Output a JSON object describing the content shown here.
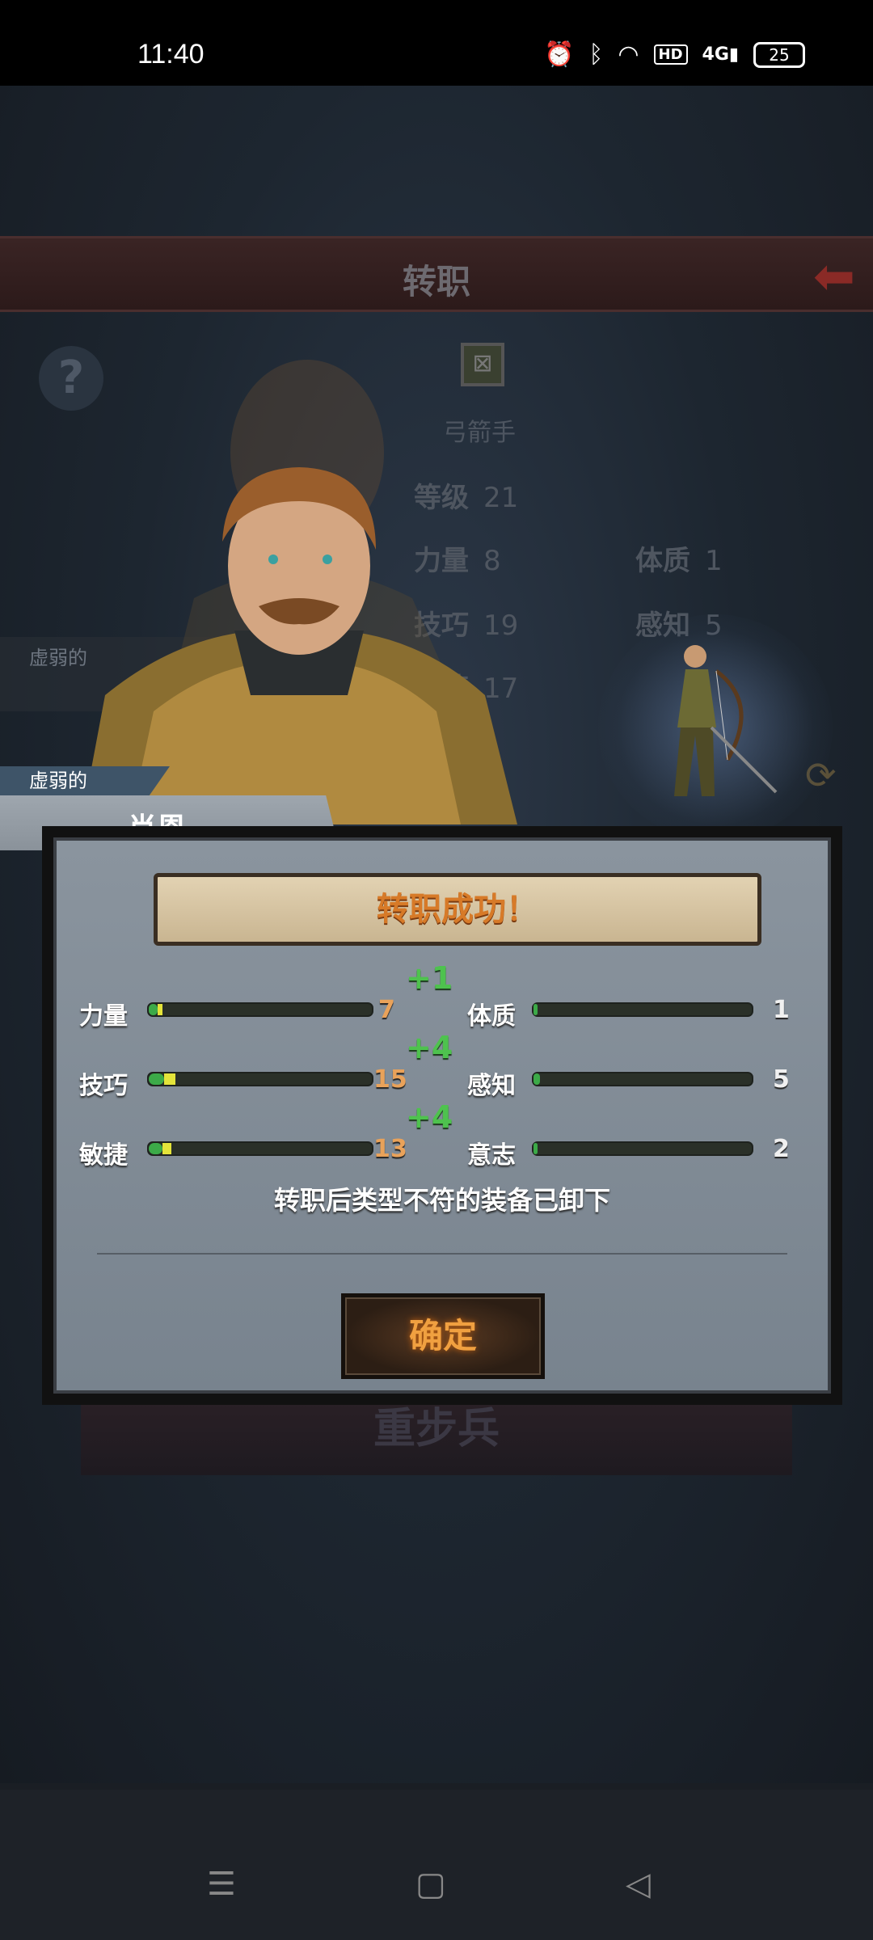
{
  "status_bar": {
    "time": "11:40",
    "icons": [
      "alarm-icon",
      "bluetooth-icon",
      "wifi-icon",
      "hd-icon",
      "signal-4g-icon",
      "battery-icon"
    ],
    "hd": "HD",
    "network": "4G",
    "battery": "25"
  },
  "background_screen": {
    "title": "转职",
    "class_name": "弓箭手",
    "stats": [
      {
        "label": "等级",
        "value": "21"
      },
      {
        "label": "力量",
        "value": "8"
      },
      {
        "label": "体质",
        "value": "1"
      },
      {
        "label": "技巧",
        "value": "19"
      },
      {
        "label": "感知",
        "value": "5"
      },
      {
        "label": "敏捷",
        "value": "17"
      }
    ],
    "tag_sub": "虚弱的",
    "bottom_label": "重步兵"
  },
  "hero": {
    "trait": "虚弱的",
    "name": "肖恩"
  },
  "dialog": {
    "title": "转职成功！",
    "stats_left": [
      {
        "label": "力量",
        "value": "7",
        "gain": "+1",
        "fill": 0.04,
        "gain_fill": 0.02
      },
      {
        "label": "技巧",
        "value": "15",
        "gain": "+4",
        "fill": 0.12,
        "gain_fill": 0.06
      },
      {
        "label": "敏捷",
        "value": "13",
        "gain": "+4",
        "fill": 0.1,
        "gain_fill": 0.06
      }
    ],
    "stats_right": [
      {
        "label": "体质",
        "value": "1",
        "fill": 0.02
      },
      {
        "label": "感知",
        "value": "5",
        "fill": 0.03
      },
      {
        "label": "意志",
        "value": "2",
        "fill": 0.02
      }
    ],
    "notice": "转职后类型不符的装备已卸下",
    "confirm_label": "确定"
  },
  "colors": {
    "title_text": "#d77a28",
    "stat_value": "#e9a25a",
    "gain_text": "#4ec24e",
    "bar_fill": "#3caa48",
    "bar_gain": "#e4e43a"
  }
}
